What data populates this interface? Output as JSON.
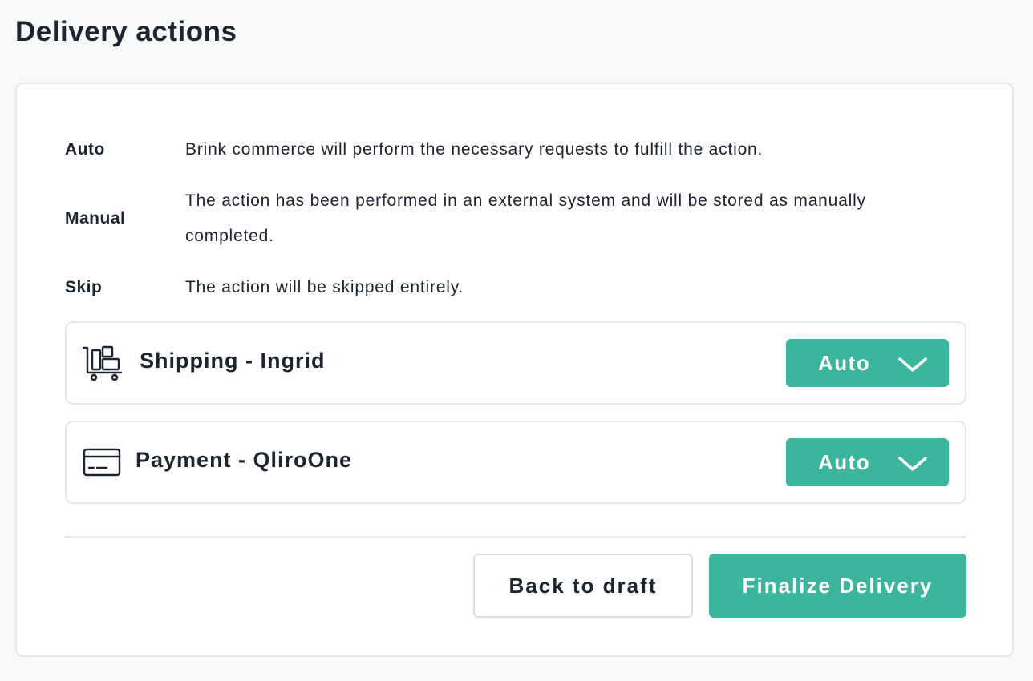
{
  "page": {
    "title": "Delivery actions"
  },
  "legend": [
    {
      "term": "Auto",
      "description": "Brink commerce will perform the necessary requests to fulfill the action."
    },
    {
      "term": "Manual",
      "description": "The action has been performed in an external system and will be stored as manually completed."
    },
    {
      "term": "Skip",
      "description": "The action will be skipped entirely."
    }
  ],
  "actions": [
    {
      "label": "Shipping - Ingrid",
      "icon": "shipping-cart-icon",
      "mode": "Auto"
    },
    {
      "label": "Payment - QliroOne",
      "icon": "credit-card-icon",
      "mode": "Auto"
    }
  ],
  "buttons": {
    "back_label": "Back to draft",
    "finalize_label": "Finalize Delivery"
  },
  "colors": {
    "accent": "#3bb59b",
    "text": "#1c2430",
    "border": "#e4e7ec",
    "background": "#f7f8fa"
  }
}
